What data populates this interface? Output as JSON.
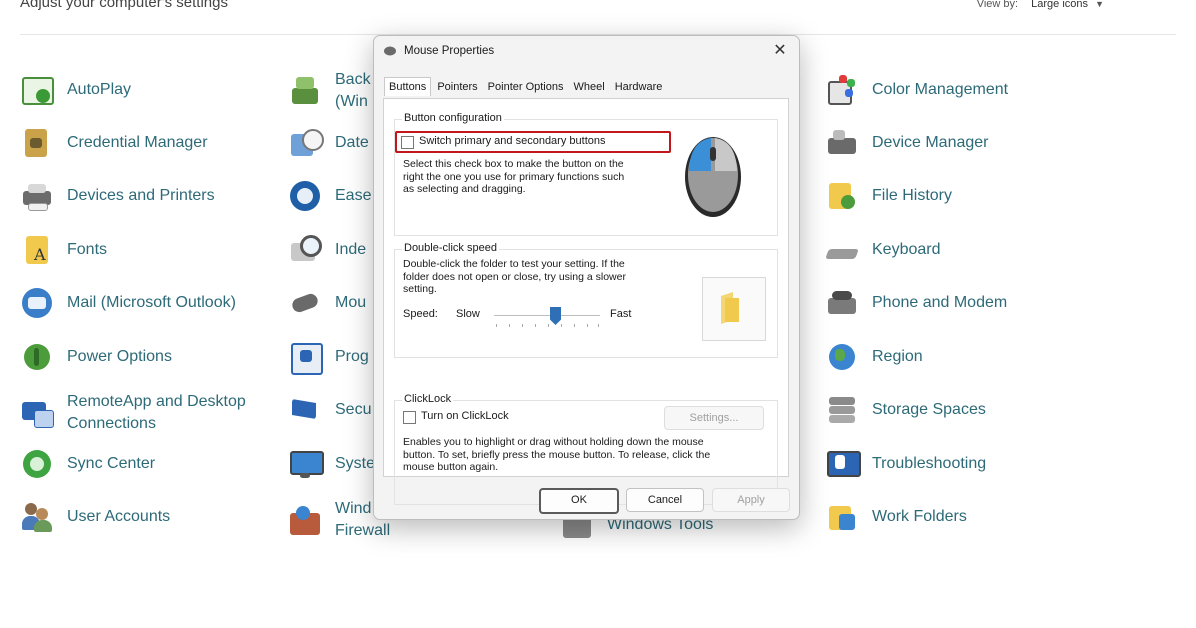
{
  "header": {
    "title": "Adjust your computer's settings",
    "view_by_label": "View by:",
    "view_by_value": "Large icons"
  },
  "items": {
    "autoplay": "AutoPlay",
    "backup": "Back",
    "backup_2": "(Win",
    "color_management": "Color Management",
    "credential_manager": "Credential Manager",
    "date": "Date",
    "device_manager": "Device Manager",
    "devices_printers": "Devices and Printers",
    "ease": "Ease",
    "file_history": "File History",
    "fonts": "Fonts",
    "indexing": "Inde",
    "keyboard": "Keyboard",
    "mail": "Mail (Microsoft Outlook)",
    "mouse": "Mou",
    "phone_modem": "Phone and Modem",
    "power_options": "Power Options",
    "programs": "Prog",
    "region": "Region",
    "remoteapp_1": "RemoteApp and Desktop",
    "remoteapp_2": "Connections",
    "security": "Secu",
    "storage_spaces": "Storage Spaces",
    "sync_center": "Sync Center",
    "system": "Syste",
    "troubleshooting": "Troubleshooting",
    "user_accounts": "User Accounts",
    "firewall_1": "Wind",
    "firewall_2": "Firewall",
    "windows_tools": "Windows Tools",
    "work_folders": "Work Folders"
  },
  "dialog": {
    "title": "Mouse Properties",
    "close_glyph": "✕",
    "tabs": [
      "Buttons",
      "Pointers",
      "Pointer Options",
      "Wheel",
      "Hardware"
    ],
    "button_config": {
      "label": "Button configuration",
      "checkbox_label": "Switch primary and secondary buttons",
      "desc_1": "Select this check box to make the button on the",
      "desc_2": "right the one you use for primary functions such",
      "desc_3": "as selecting and dragging."
    },
    "double_click": {
      "label": "Double-click speed",
      "desc_1": "Double-click the folder to test your setting. If the",
      "desc_2": "folder does not open or close, try using a slower",
      "desc_3": "setting.",
      "speed_label": "Speed:",
      "slow_label": "Slow",
      "fast_label": "Fast"
    },
    "clicklock": {
      "label": "ClickLock",
      "checkbox_label": "Turn on ClickLock",
      "settings_button": "Settings...",
      "desc_1": "Enables you to highlight or drag without holding down the mouse",
      "desc_2": "button. To set, briefly press the mouse button. To release, click the",
      "desc_3": "mouse button again."
    },
    "buttons": {
      "ok": "OK",
      "cancel": "Cancel",
      "apply": "Apply"
    }
  },
  "colors": {
    "link": "#2d6a78",
    "highlight": "#c0161c",
    "slider_thumb": "#2f6fb5"
  }
}
